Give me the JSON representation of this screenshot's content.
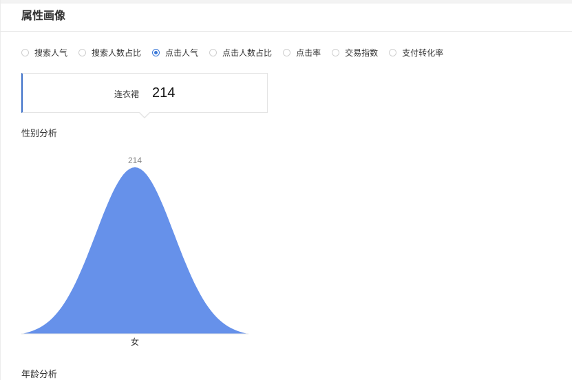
{
  "section": {
    "title": "属性画像"
  },
  "metrics": {
    "options": [
      {
        "label": "搜索人气",
        "checked": false
      },
      {
        "label": "搜索人数占比",
        "checked": false
      },
      {
        "label": "点击人气",
        "checked": true
      },
      {
        "label": "点击人数占比",
        "checked": false
      },
      {
        "label": "点击率",
        "checked": false
      },
      {
        "label": "交易指数",
        "checked": false
      },
      {
        "label": "支付转化率",
        "checked": false
      }
    ]
  },
  "tooltip": {
    "label": "连衣裙",
    "value": "214"
  },
  "gender_section": {
    "title": "性别分析"
  },
  "age_section": {
    "title": "年龄分析"
  },
  "colors": {
    "accent": "#3a78d8",
    "series_fill": "#6691ea",
    "tooltip_border": "#3b6fc8"
  },
  "chart_data": {
    "type": "area",
    "categories": [
      "女"
    ],
    "values": [
      214
    ],
    "data_labels": [
      "214"
    ],
    "title": "",
    "xlabel": "",
    "ylabel": "",
    "ylim": [
      0,
      214
    ],
    "grid": false,
    "legend": "none"
  }
}
